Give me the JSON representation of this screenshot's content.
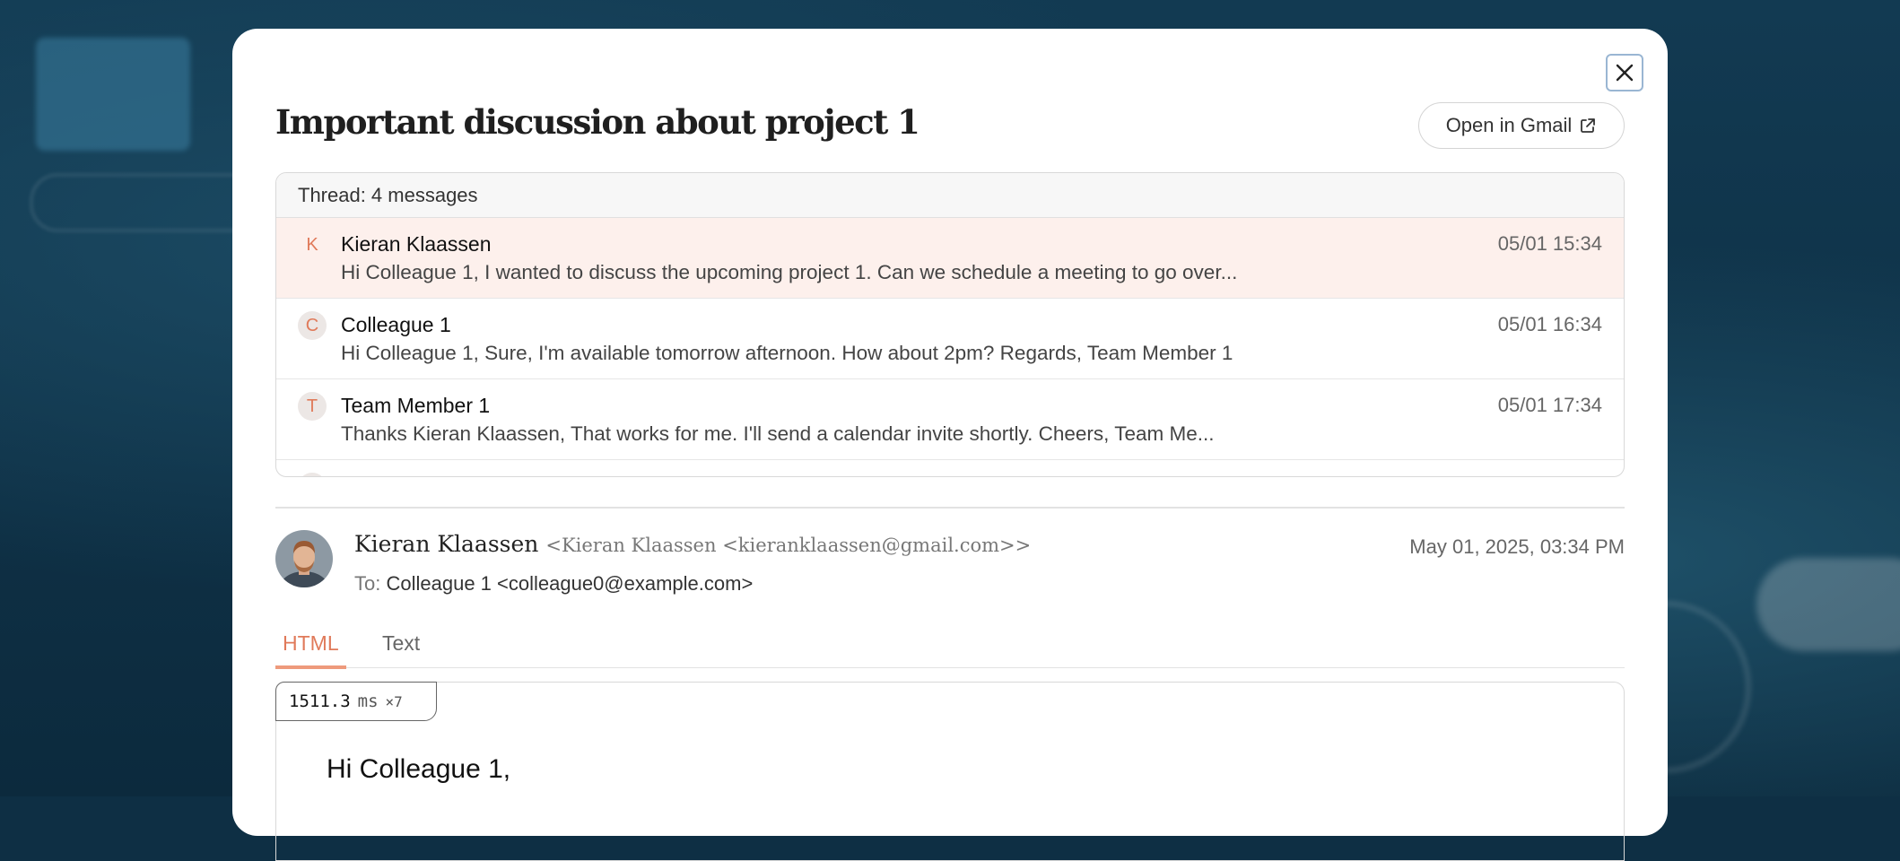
{
  "modal": {
    "title": "Important discussion about project 1",
    "open_gmail_label": "Open in Gmail"
  },
  "thread": {
    "header": "Thread: 4 messages",
    "messages": [
      {
        "initial": "K",
        "sender": "Kieran Klaassen",
        "time": "05/01 15:34",
        "preview": "Hi Colleague 1, I wanted to discuss the upcoming project 1. Can we schedule a meeting to go over..."
      },
      {
        "initial": "C",
        "sender": "Colleague 1",
        "time": "05/01 16:34",
        "preview": "Hi Colleague 1, Sure, I'm available tomorrow afternoon. How about 2pm? Regards, Team Member 1"
      },
      {
        "initial": "T",
        "sender": "Team Member 1",
        "time": "05/01 17:34",
        "preview": "Thanks Kieran Klaassen, That works for me. I'll send a calendar invite shortly. Cheers, Team Me..."
      }
    ]
  },
  "message": {
    "sender_name": "Kieran Klaassen",
    "sender_email": "<Kieran Klaassen <kieranklaassen@gmail.com>>",
    "date": "May 01, 2025, 03:34 PM",
    "to_label": "To:",
    "to_value": "Colleague 1 <colleague0@example.com>"
  },
  "tabs": {
    "html": "HTML",
    "text": "Text"
  },
  "perf": {
    "value": "1511.3",
    "unit": "ms",
    "multiplier": "×7"
  },
  "body": {
    "greeting": "Hi Colleague 1,"
  },
  "colors": {
    "accent": "#e07a5a",
    "active_row": "#fdf0ec"
  }
}
